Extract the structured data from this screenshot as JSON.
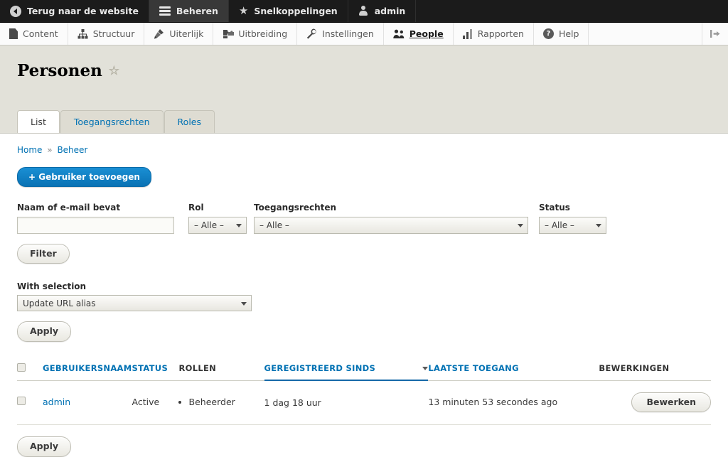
{
  "toolbar_top": {
    "items": [
      {
        "label": "Terug naar de website",
        "icon": "back-arrow-icon",
        "active": false
      },
      {
        "label": "Beheren",
        "icon": "hamburger-icon",
        "active": true
      },
      {
        "label": "Snelkoppelingen",
        "icon": "star-icon",
        "active": false
      },
      {
        "label": "admin",
        "icon": "person-icon",
        "active": false
      }
    ]
  },
  "toolbar_menu": {
    "items": [
      {
        "label": "Content",
        "icon": "document-icon",
        "active": false
      },
      {
        "label": "Structuur",
        "icon": "sitemap-icon",
        "active": false
      },
      {
        "label": "Uiterlijk",
        "icon": "paintbrush-icon",
        "active": false
      },
      {
        "label": "Uitbreiding",
        "icon": "puzzle-piece-icon",
        "active": false
      },
      {
        "label": "Instellingen",
        "icon": "wrench-icon",
        "active": false
      },
      {
        "label": "People",
        "icon": "people-icon",
        "active": true
      },
      {
        "label": "Rapporten",
        "icon": "bar-chart-icon",
        "active": false
      },
      {
        "label": "Help",
        "icon": "question-mark-icon",
        "active": false
      }
    ],
    "collapse_icon": "collapse-toolbar-icon"
  },
  "header": {
    "title": "Personen",
    "favorite_icon": "star-outline-icon",
    "tabs": [
      {
        "label": "List",
        "active": true
      },
      {
        "label": "Toegangsrechten",
        "active": false
      },
      {
        "label": "Roles",
        "active": false
      }
    ]
  },
  "breadcrumb": {
    "items": [
      "Home",
      "Beheer"
    ],
    "separator": "»"
  },
  "actions": {
    "add_user_label": "+ Gebruiker toevoegen"
  },
  "filters": {
    "name_label": "Naam of e-mail bevat",
    "name_value": "",
    "name_placeholder": "",
    "role_label": "Rol",
    "role_value": "– Alle –",
    "permission_label": "Toegangsrechten",
    "permission_value": "– Alle –",
    "status_label": "Status",
    "status_value": "– Alle –",
    "filter_button": "Filter"
  },
  "bulk": {
    "label": "With selection",
    "action_value": "Update URL alias",
    "apply_label": "Apply"
  },
  "table": {
    "select_all_icon": "checkbox-icon",
    "columns": [
      {
        "label": "GEBRUIKERSNAAM",
        "link": true,
        "sorted": false
      },
      {
        "label": "STATUS",
        "link": true,
        "sorted": false
      },
      {
        "label": "ROLLEN",
        "link": false,
        "sorted": false
      },
      {
        "label": "GEREGISTREERD SINDS",
        "link": true,
        "sorted": true,
        "sort_dir": "desc"
      },
      {
        "label": "LAATSTE TOEGANG",
        "link": true,
        "sorted": false
      },
      {
        "label": "BEWERKINGEN",
        "link": false,
        "sorted": false
      }
    ],
    "rows": [
      {
        "username": "admin",
        "status": "Active",
        "roles": [
          "Beheerder"
        ],
        "registered": "1 dag 18 uur",
        "last_access": "13 minuten 53 secondes ago",
        "operation": "Bewerken"
      }
    ]
  },
  "footer": {
    "apply_label": "Apply"
  },
  "colors": {
    "link": "#0071b3",
    "primary_button": "#0c7ec4",
    "toolbar_bg": "#1b1b1b",
    "header_bg": "#e2e1d9",
    "sorted_underline": "#1669a8"
  }
}
